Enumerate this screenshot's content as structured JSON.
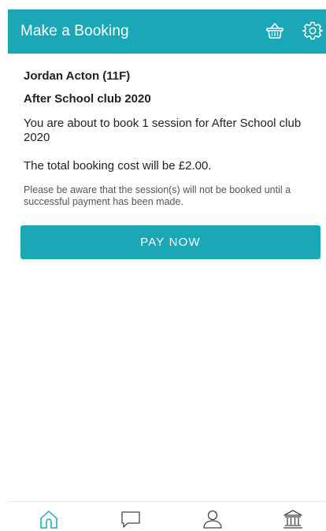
{
  "header": {
    "title": "Make a Booking",
    "icons": [
      "basket-icon",
      "gear-icon"
    ],
    "background_color": "#1aa7b6"
  },
  "booking": {
    "student": "Jordan Acton (11F)",
    "club": "After School club 2020",
    "session_message": "You are about to book 1 session for After School club 2020",
    "cost_message": "The total booking cost will be £2.00.",
    "notice": "Please be aware that the session(s) will not be booked until a successful payment has been made."
  },
  "actions": {
    "pay_label": "PAY NOW",
    "pay_color": "#1aa7b6"
  },
  "bottom_nav": {
    "items": [
      "home-icon",
      "messages-icon",
      "profile-icon",
      "bank-icon"
    ],
    "icon_color": "#1aa7b6"
  }
}
